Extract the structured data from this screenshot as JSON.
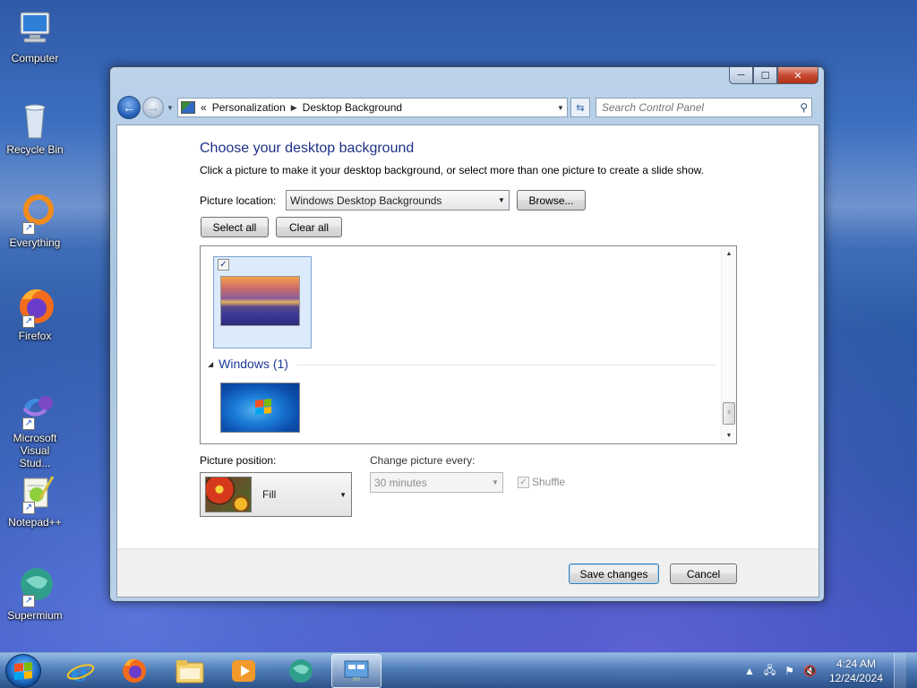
{
  "desktop": {
    "icons": [
      {
        "label": "Computer"
      },
      {
        "label": "Recycle Bin"
      },
      {
        "label": "Everything"
      },
      {
        "label": "Firefox"
      },
      {
        "label": "Microsoft Visual Stud..."
      },
      {
        "label": "Notepad++"
      },
      {
        "label": "Supermium"
      }
    ]
  },
  "window": {
    "caption": {
      "minimize": "─",
      "maximize": "☐",
      "close": "✕"
    },
    "address": {
      "overflow": "«",
      "parts": [
        "Personalization",
        "Desktop Background"
      ]
    },
    "search": {
      "placeholder": "Search Control Panel"
    },
    "main": {
      "title": "Choose your desktop background",
      "description": "Click a picture to make it your desktop background, or select more than one picture to create a slide show.",
      "picture_location_label": "Picture location:",
      "picture_location_value": "Windows Desktop Backgrounds",
      "browse_label": "Browse...",
      "select_all_label": "Select all",
      "clear_all_label": "Clear all",
      "gallery": {
        "group_header": "Windows (1)",
        "first_item_checked": true
      },
      "picture_position_label": "Picture position:",
      "picture_position_value": "Fill",
      "change_picture_label": "Change picture every:",
      "change_picture_value": "30 minutes",
      "shuffle_label": "Shuffle"
    },
    "footer": {
      "save_label": "Save changes",
      "cancel_label": "Cancel"
    }
  },
  "taskbar": {
    "clock_time": "4:24 AM",
    "clock_date": "12/24/2024"
  },
  "colors": {
    "title_text": "#1e3287",
    "group_header": "#1e3a98",
    "selection_bg": "#dcebfc"
  }
}
